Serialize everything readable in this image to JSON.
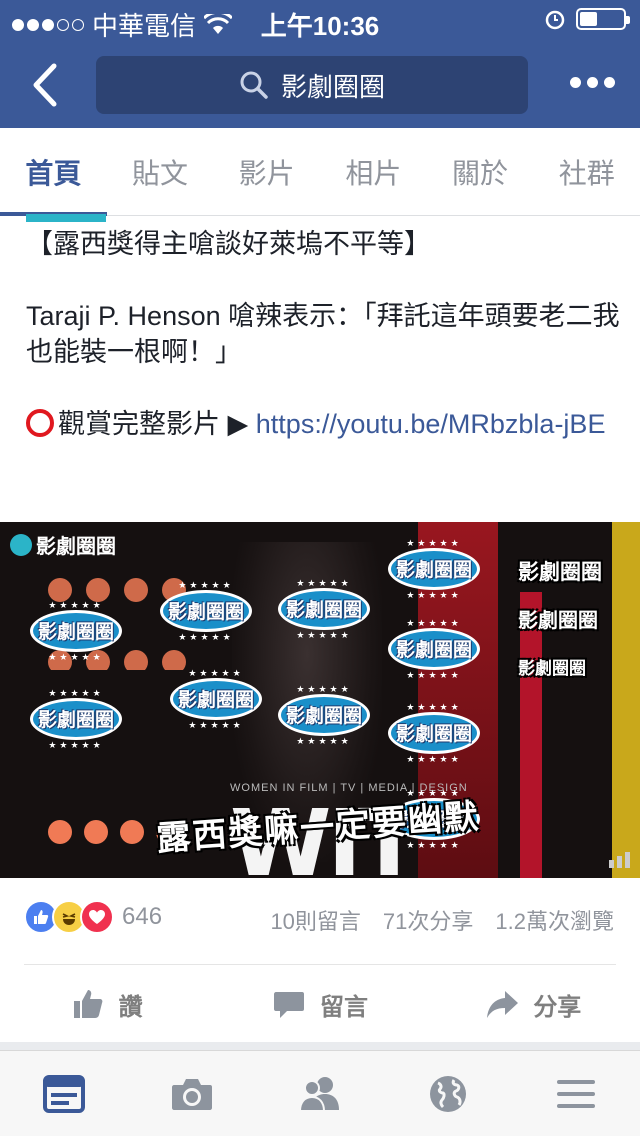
{
  "status_bar": {
    "carrier": "中華電信",
    "time": "上午10:36",
    "signal_bars": 3,
    "signal_total": 5,
    "battery_level": 0.4
  },
  "nav": {
    "search_text": "影劇圈圈",
    "back_icon": "chevron-left-icon",
    "more_icon": "more-icon"
  },
  "tabs": [
    "首頁",
    "貼文",
    "影片",
    "相片",
    "關於",
    "社群"
  ],
  "active_tab": 0,
  "post": {
    "title": "【露西獎得主嗆談好萊塢不平等】",
    "body": "Taraji P. Henson 嗆辣表示：「拜託這年頭要老二我也能裝一根啊！」",
    "cta_prefix": "觀賞完整影片 ▶",
    "link": "https://youtu.be/MRbzbla-jBE"
  },
  "video": {
    "corner_logo": "影劇圈圈",
    "watermark": "影劇圈圈",
    "subtitle": "露西獎嘛一定要幽默",
    "stage_text": "WIT",
    "stage_subtext": "WOMEN IN FILM | TV | MEDIA | DESIGN"
  },
  "reactions": {
    "count": "646",
    "types": [
      "like",
      "haha",
      "love"
    ]
  },
  "stats": {
    "comments": "10則留言",
    "shares": "71次分享",
    "views": "1.2萬次瀏覽"
  },
  "actions": {
    "like": "讚",
    "comment": "留言",
    "share": "分享"
  },
  "colors": {
    "brand": "#3b5998",
    "link": "#3b5998",
    "muted": "#90949c"
  },
  "bottom_tabs": [
    "news-feed-icon",
    "camera-icon",
    "friends-icon",
    "globe-icon",
    "menu-icon"
  ],
  "active_bottom_tab": 0
}
